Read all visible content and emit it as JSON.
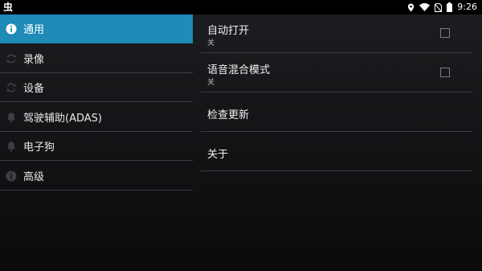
{
  "status_bar": {
    "app_icon_glyph": "虫",
    "time": "9:26",
    "icons": [
      "location-icon",
      "wifi-icon",
      "no-sim-icon",
      "battery-icon"
    ]
  },
  "sidebar": {
    "items": [
      {
        "label": "通用",
        "icon": "info-icon",
        "active": true
      },
      {
        "label": "录像",
        "icon": "sync-icon",
        "active": false
      },
      {
        "label": "设备",
        "icon": "sync-icon",
        "active": false
      },
      {
        "label": "驾驶辅助(ADAS)",
        "icon": "bell-icon",
        "active": false
      },
      {
        "label": "电子狗",
        "icon": "bell-icon",
        "active": false
      },
      {
        "label": "高级",
        "icon": "info-icon",
        "active": false
      }
    ]
  },
  "settings": {
    "items": [
      {
        "title": "自动打开",
        "summary": "关",
        "checkbox": true,
        "checked": false
      },
      {
        "title": "语音混合模式",
        "summary": "关",
        "checkbox": true,
        "checked": false
      },
      {
        "title": "检查更新",
        "summary": "",
        "checkbox": false
      },
      {
        "title": "关于",
        "summary": "",
        "checkbox": false
      }
    ]
  },
  "colors": {
    "accent": "#1e8bb8",
    "divider": "#3a3c40",
    "background": "#141517"
  }
}
